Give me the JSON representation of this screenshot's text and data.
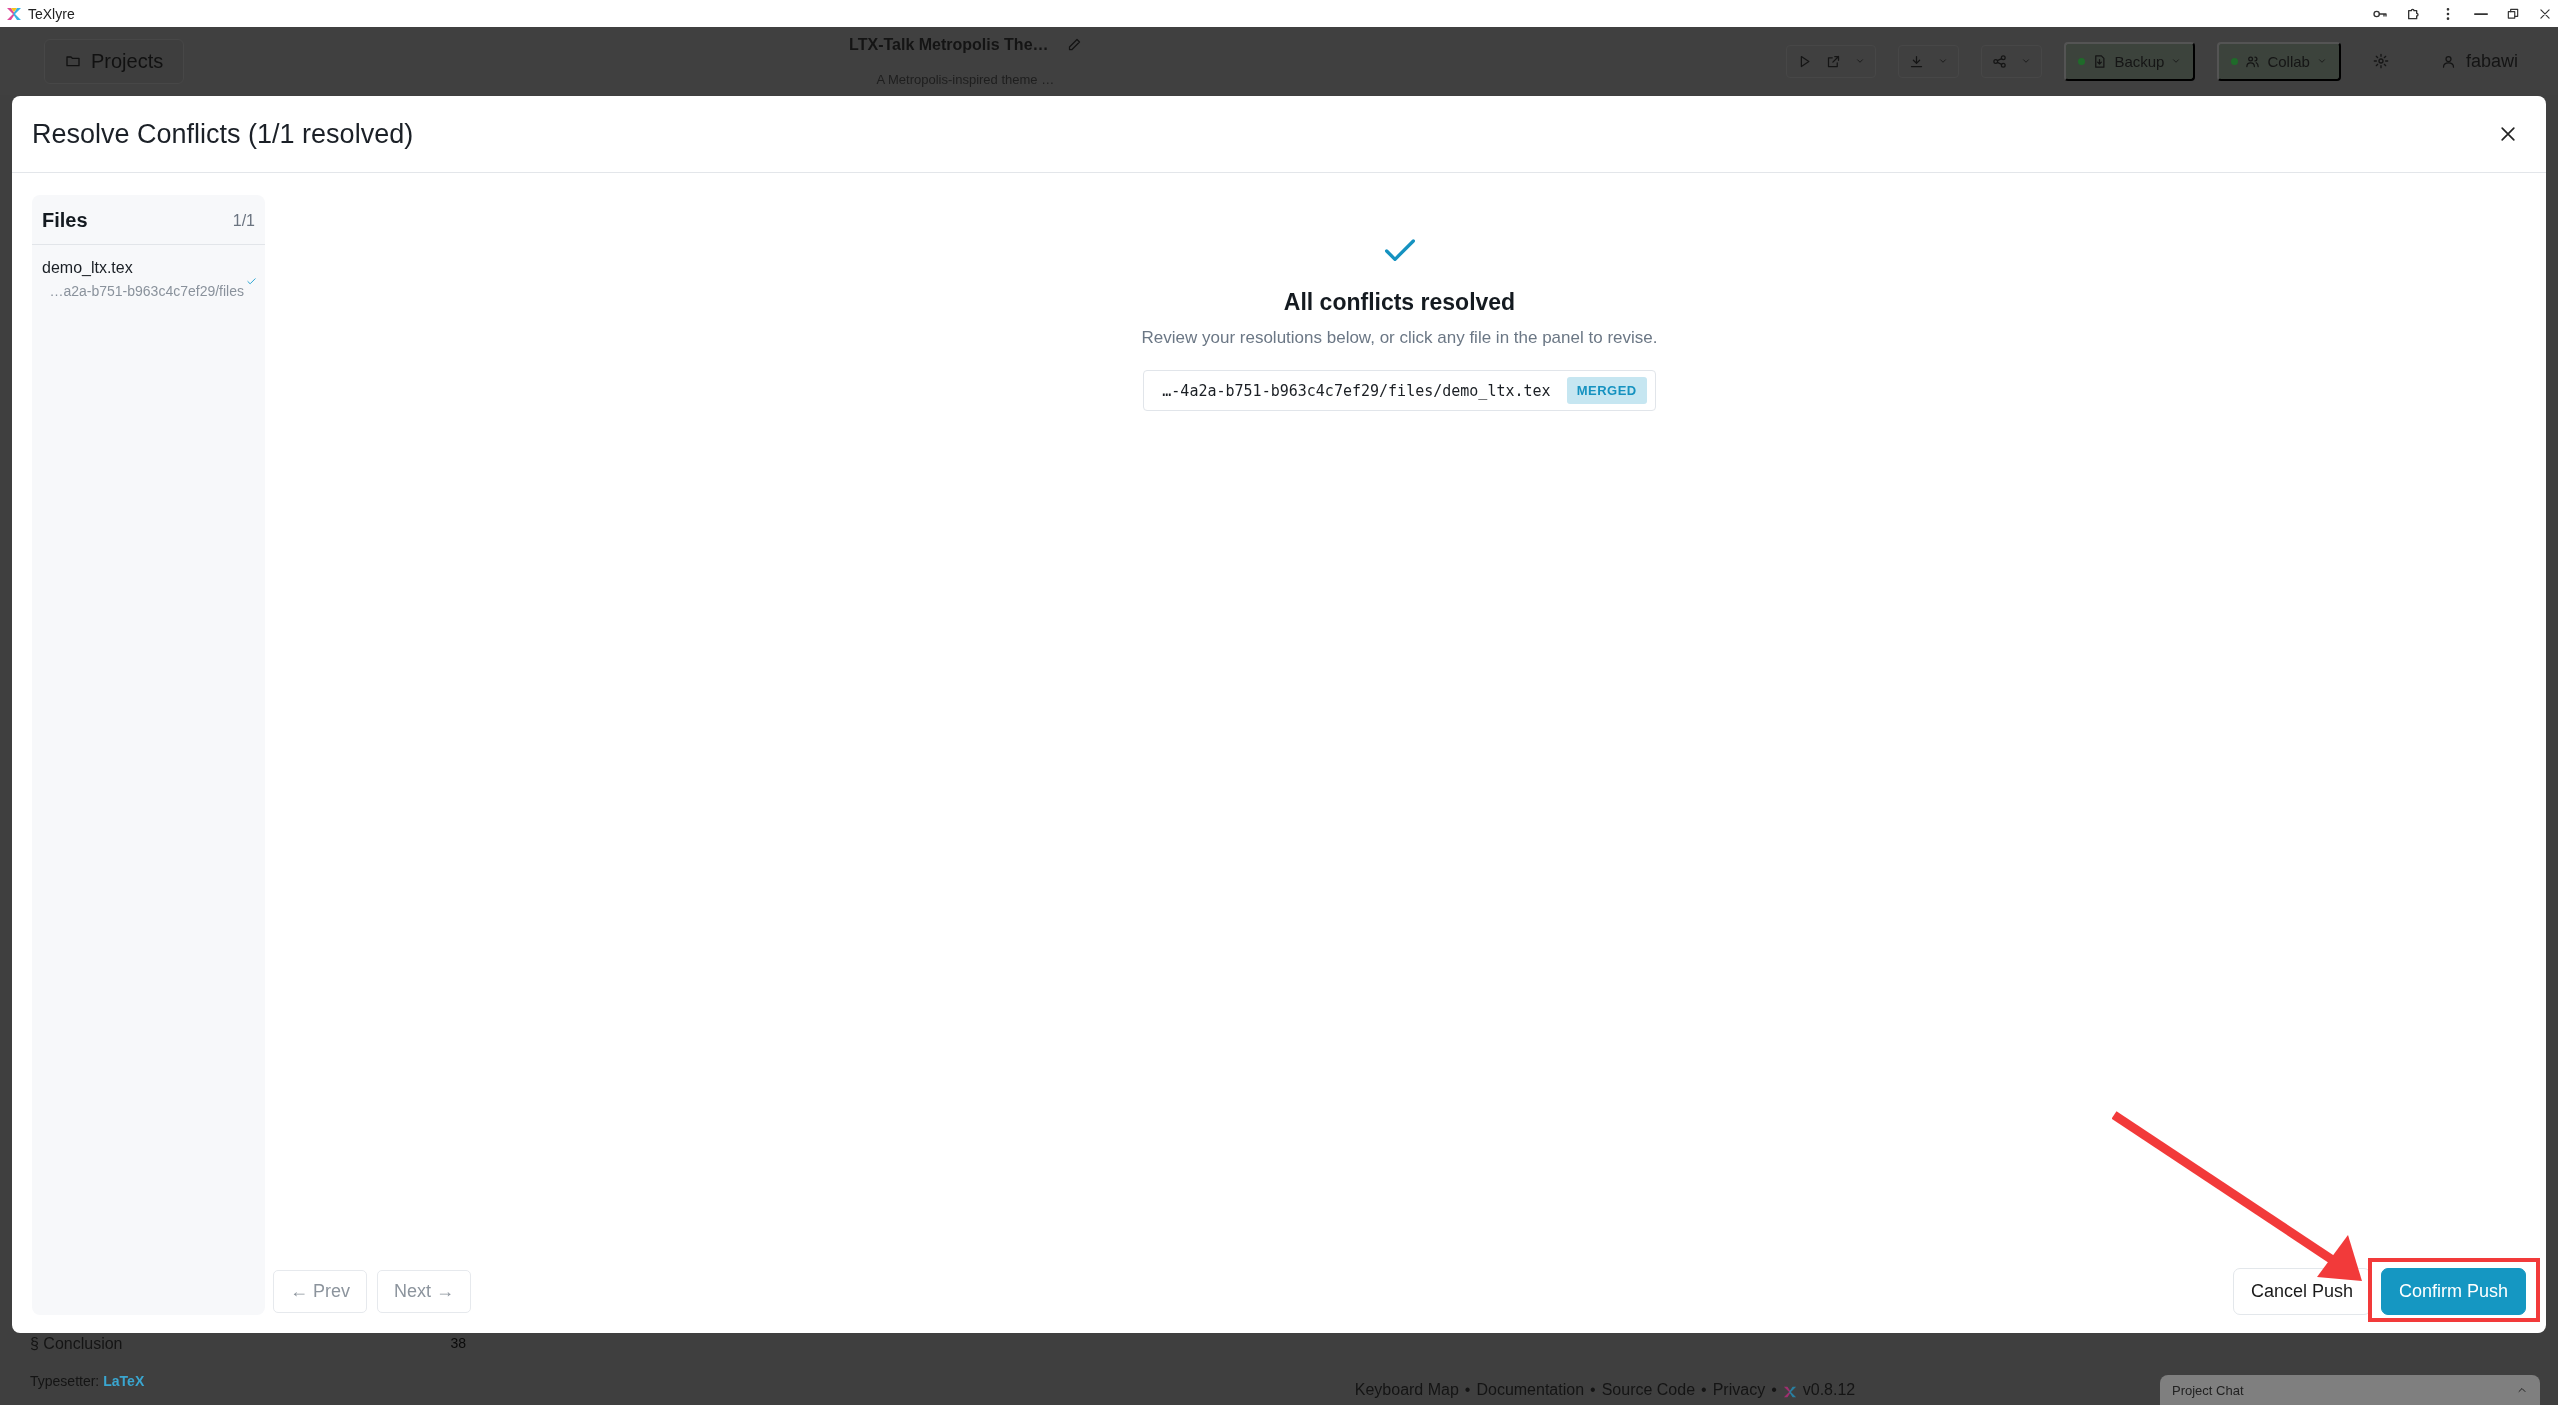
{
  "browser": {
    "title": "TeXlyre"
  },
  "header": {
    "projects_button": "Projects",
    "project_title": "LTX-Talk Metropolis The…",
    "project_description": "A Metropolis-inspired theme …",
    "sync_buttons": [
      {
        "label": "Backup",
        "connected": true,
        "kind": "backup"
      },
      {
        "label": "Collab",
        "connected": true,
        "kind": "collab"
      }
    ],
    "user": "fabawi"
  },
  "modal": {
    "title": "Resolve Conflicts (1/1 resolved)",
    "files_panel": {
      "title": "Files",
      "count": "1/1",
      "files": [
        {
          "name": "demo_ltx.tex",
          "path": "…a2a-b751-b963c4c7ef29/files",
          "resolved": true
        }
      ]
    },
    "summary": {
      "heading": "All conflicts resolved",
      "text": "Review your resolutions below, or click any file in the panel to revise.",
      "results": [
        {
          "path": "…-4a2a-b751-b963c4c7ef29/files/demo_ltx.tex",
          "status": "MERGED"
        }
      ]
    },
    "nav_buttons": [
      {
        "label": "← Prev",
        "disabled": true
      },
      {
        "label": "Next →",
        "disabled": true
      }
    ],
    "actions": [
      {
        "label": "Cancel Push",
        "kind": "secondary"
      },
      {
        "label": "Confirm Push",
        "kind": "primary",
        "highlighted": true
      }
    ]
  },
  "background": {
    "outline_item": {
      "label": "§ Conclusion",
      "line": "38"
    },
    "typesetter_label": "Typesetter:",
    "typesetter": "LaTeX",
    "footer_links": [
      "Keyboard Map",
      "Documentation",
      "Source Code",
      "Privacy"
    ],
    "separator": "•",
    "version": "v0.8.12",
    "chat": "Project Chat"
  }
}
